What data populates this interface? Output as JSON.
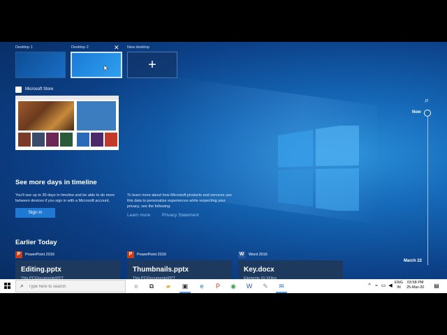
{
  "desktops": [
    {
      "label": "Desktop 1"
    },
    {
      "label": "Desktop 2"
    },
    {
      "label": "New desktop"
    }
  ],
  "store": {
    "label": "Microsoft Store"
  },
  "timeline": {
    "now": "Now",
    "date": "March 22"
  },
  "more_days": {
    "title": "See more days in timeline",
    "desc": "You'll see up to 30 days in timeline and be able to do more between devices if you sign in with a Microsoft account.",
    "signin": "Sign in",
    "privacy_desc": "To learn more about how Microsoft products and services use this data to personalize experiences while respecting your privacy, see the following:",
    "learn_more": "Learn more",
    "privacy": "Privacy Statement"
  },
  "earlier": {
    "title": "Earlier Today",
    "items": [
      {
        "app": "PowerPoint 2016",
        "title": "Editing.pptx",
        "path": "This PC\\Documents\\PPT"
      },
      {
        "app": "PowerPoint 2016",
        "title": "Thumbnails.pptx",
        "path": "This PC\\Documents\\PPT"
      },
      {
        "app": "Word 2016",
        "title": "Key.docx",
        "path": "Elements (G:)\\Files"
      }
    ]
  },
  "taskbar": {
    "search_placeholder": "Type here to search",
    "lang_1": "ENG",
    "lang_2": "IN",
    "time": "03:58 PM",
    "date": "25-Mar-20"
  },
  "colors": {
    "accent": "#1f78d1",
    "ppt": "#c43e1c",
    "word": "#2b579a"
  }
}
